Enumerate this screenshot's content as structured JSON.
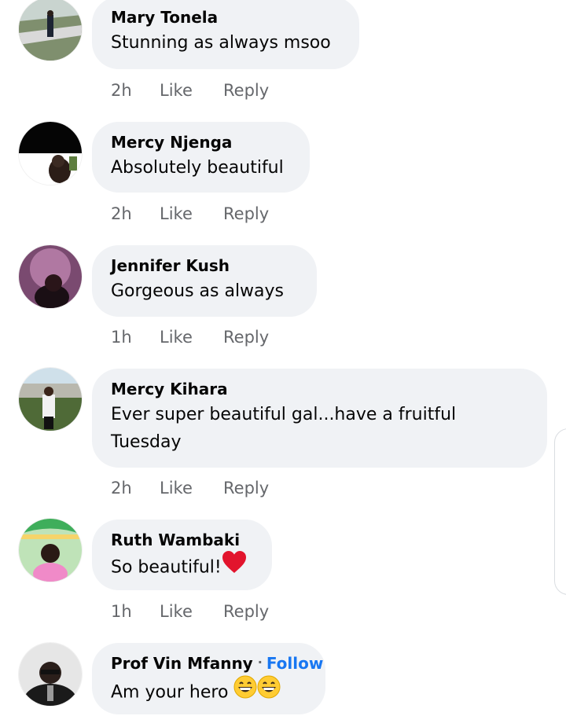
{
  "comments": [
    {
      "name": "Mary Tonela",
      "text": "Stunning as always msoo",
      "time": "2h",
      "like": "Like",
      "reply": "Reply"
    },
    {
      "name": "Mercy Njenga",
      "text": "Absolutely beautiful",
      "time": "2h",
      "like": "Like",
      "reply": "Reply"
    },
    {
      "name": "Jennifer Kush",
      "text": "Gorgeous as always",
      "time": "1h",
      "like": "Like",
      "reply": "Reply"
    },
    {
      "name": "Mercy Kihara",
      "text_line1": "Ever super beautiful gal...have a fruitful",
      "text_line2": "Tuesday",
      "time": "2h",
      "like": "Like",
      "reply": "Reply"
    },
    {
      "name": "Ruth Wambaki",
      "text": "So beautiful!",
      "time": "1h",
      "like": "Like",
      "reply": "Reply"
    },
    {
      "name": "Prof Vin Mfanny",
      "separator": "·",
      "follow": "Follow",
      "text": "Am your hero"
    }
  ],
  "icons": {
    "heart": "red-heart-emoji",
    "grin": "grinning-face-emoji"
  },
  "colors": {
    "bubble": "#f0f2f5",
    "meta": "#65676b",
    "link": "#1877f2",
    "heart": "#e2142d",
    "emoji": "#ffcc33"
  }
}
